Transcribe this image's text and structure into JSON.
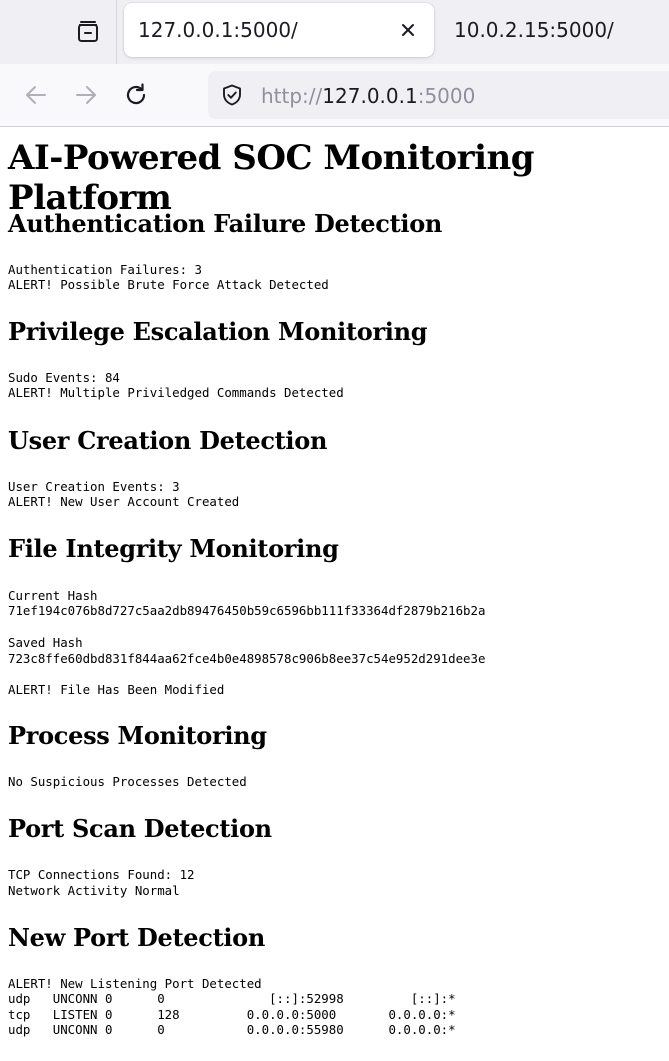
{
  "browser": {
    "tabs": [
      {
        "title": "127.0.0.1:5000/",
        "active": true
      },
      {
        "title": "10.0.2.15:5000/",
        "active": false
      }
    ],
    "url": {
      "scheme": "http://",
      "host": "127.0.0.1",
      "port": ":5000"
    },
    "icons": {
      "tab_list": "tab-list-icon",
      "close": "close-icon",
      "back": "back-arrow-icon",
      "forward": "forward-arrow-icon",
      "reload": "reload-icon",
      "site_security": "shield-icon"
    }
  },
  "page": {
    "title": "AI-Powered SOC Monitoring Platform",
    "sections": {
      "auth": {
        "heading": "Authentication Failure Detection",
        "line1": "Authentication Failures: 3",
        "line2": "ALERT! Possible Brute Force Attack Detected"
      },
      "priv": {
        "heading": "Privilege Escalation Monitoring",
        "line1": "Sudo Events: 84",
        "line2": "ALERT! Multiple Priviledged Commands Detected"
      },
      "user": {
        "heading": "User Creation Detection",
        "line1": "User Creation Events: 3",
        "line2": "ALERT! New User Account Created"
      },
      "fim": {
        "heading": "File Integrity Monitoring",
        "current_label": "Current Hash",
        "current_hash": "71ef194c076b8d727c5aa2db89476450b59c6596bb111f33364df2879b216b2a",
        "saved_label": "Saved Hash",
        "saved_hash": "723c8ffe60dbd831f844aa62fce4b0e4898578c906b8ee37c54e952d291dee3e",
        "alert": "ALERT! File Has Been Modified"
      },
      "proc": {
        "heading": "Process Monitoring",
        "line1": "No Suspicious Processes Detected"
      },
      "portscan": {
        "heading": "Port Scan Detection",
        "line1": "TCP Connections Found: 12",
        "line2": "Network Activity Normal"
      },
      "newport": {
        "heading": "New Port Detection",
        "alert": "ALERT! New Listening Port Detected",
        "rows": [
          "udp   UNCONN 0      0              [::]:52998         [::]:*",
          "tcp   LISTEN 0      128         0.0.0.0:5000       0.0.0.0:*",
          "udp   UNCONN 0      0           0.0.0.0:55980      0.0.0.0:*"
        ]
      }
    }
  }
}
